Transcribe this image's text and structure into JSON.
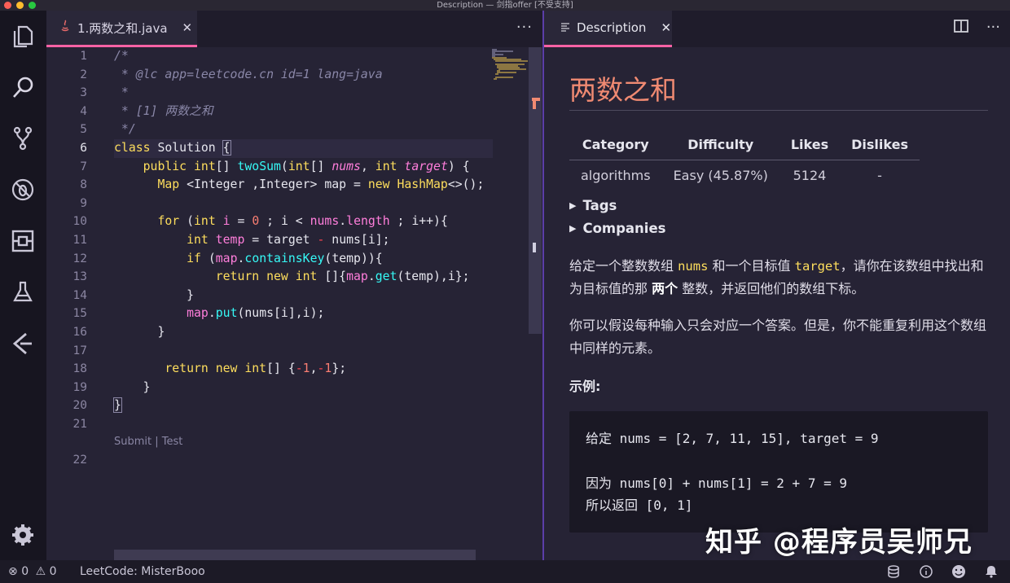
{
  "window": {
    "title": "Description — 剑指offer [不受支持]",
    "traffic_colors": [
      "#ff5f57",
      "#febc2e",
      "#28c840"
    ]
  },
  "colors": {
    "accent": "#ff62a5",
    "split": "#5b3ea8",
    "keyword": "#fede5d",
    "function": "#36f9f6",
    "variable": "#ff7edb",
    "comment": "#8a87a8",
    "number": "#f97e72",
    "heading": "#f08a72"
  },
  "activity_bar": {
    "icons": [
      "files-icon",
      "search-icon",
      "source-control-icon",
      "debug-icon",
      "extensions-icon",
      "test-flask-icon",
      "leetcode-icon",
      "gear-icon"
    ]
  },
  "editor": {
    "tab": {
      "icon": "java-icon",
      "label": "1.两数之和.java",
      "close": "✕"
    },
    "more": "···",
    "lines": [
      {
        "n": "1",
        "segs": [
          [
            "cm",
            "/*"
          ]
        ]
      },
      {
        "n": "2",
        "segs": [
          [
            "cm",
            " * @lc app=leetcode.cn id=1 lang=java"
          ]
        ]
      },
      {
        "n": "3",
        "segs": [
          [
            "cm",
            " *"
          ]
        ]
      },
      {
        "n": "4",
        "segs": [
          [
            "cm",
            " * [1] 两数之和"
          ]
        ]
      },
      {
        "n": "5",
        "segs": [
          [
            "cm",
            " */"
          ]
        ]
      },
      {
        "n": "6",
        "segs": [
          [
            "kw",
            "class "
          ],
          [
            "pl",
            "Solution "
          ],
          [
            "bracket",
            "{"
          ]
        ]
      },
      {
        "n": "7",
        "segs": [
          [
            "pl",
            "    "
          ],
          [
            "kw",
            "public "
          ],
          [
            "ty",
            "int"
          ],
          [
            "pl",
            "[] "
          ],
          [
            "fn",
            "twoSum"
          ],
          [
            "pl",
            "("
          ],
          [
            "ty",
            "int"
          ],
          [
            "pl",
            "[] "
          ],
          [
            "pa",
            "nums"
          ],
          [
            "pl",
            ", "
          ],
          [
            "ty",
            "int "
          ],
          [
            "pa",
            "target"
          ],
          [
            "pl",
            ") {"
          ]
        ]
      },
      {
        "n": "8",
        "segs": [
          [
            "pl",
            "      "
          ],
          [
            "ty",
            "Map "
          ],
          [
            "pl",
            "<Integer ,Integer> map = "
          ],
          [
            "kw",
            "new "
          ],
          [
            "ty",
            "HashMap"
          ],
          [
            "pl",
            "<>();"
          ]
        ]
      },
      {
        "n": "9",
        "segs": []
      },
      {
        "n": "10",
        "segs": [
          [
            "pl",
            "      "
          ],
          [
            "kw",
            "for "
          ],
          [
            "pl",
            "("
          ],
          [
            "ty",
            "int "
          ],
          [
            "va",
            "i"
          ],
          [
            "pl",
            " = "
          ],
          [
            "nu",
            "0"
          ],
          [
            "pl",
            " ; i < "
          ],
          [
            "va",
            "nums"
          ],
          [
            "pl",
            "."
          ],
          [
            "va",
            "length"
          ],
          [
            "pl",
            " ; i++){"
          ]
        ]
      },
      {
        "n": "11",
        "segs": [
          [
            "pl",
            "          "
          ],
          [
            "ty",
            "int "
          ],
          [
            "va",
            "temp"
          ],
          [
            "pl",
            " = target "
          ],
          [
            "op",
            "-"
          ],
          [
            "pl",
            " nums[i];"
          ]
        ]
      },
      {
        "n": "12",
        "segs": [
          [
            "pl",
            "          "
          ],
          [
            "kw",
            "if "
          ],
          [
            "pl",
            "("
          ],
          [
            "va",
            "map"
          ],
          [
            "pl",
            "."
          ],
          [
            "fn",
            "containsKey"
          ],
          [
            "pl",
            "(temp)){"
          ]
        ]
      },
      {
        "n": "13",
        "segs": [
          [
            "pl",
            "              "
          ],
          [
            "kw",
            "return new "
          ],
          [
            "ty",
            "int "
          ],
          [
            "pl",
            "[]{"
          ],
          [
            "va",
            "map"
          ],
          [
            "pl",
            "."
          ],
          [
            "fn",
            "get"
          ],
          [
            "pl",
            "(temp),i};"
          ]
        ]
      },
      {
        "n": "14",
        "segs": [
          [
            "pl",
            "          }"
          ]
        ]
      },
      {
        "n": "15",
        "segs": [
          [
            "pl",
            "          "
          ],
          [
            "va",
            "map"
          ],
          [
            "pl",
            "."
          ],
          [
            "fn",
            "put"
          ],
          [
            "pl",
            "(nums[i],i);"
          ]
        ]
      },
      {
        "n": "16",
        "segs": [
          [
            "pl",
            "      }"
          ]
        ]
      },
      {
        "n": "17",
        "segs": []
      },
      {
        "n": "18",
        "segs": [
          [
            "pl",
            "       "
          ],
          [
            "kw",
            "return new "
          ],
          [
            "ty",
            "int"
          ],
          [
            "pl",
            "[] {"
          ],
          [
            "op",
            "-"
          ],
          [
            "nu",
            "1"
          ],
          [
            "pl",
            ","
          ],
          [
            "op",
            "-"
          ],
          [
            "nu",
            "1"
          ],
          [
            "pl",
            "};"
          ]
        ]
      },
      {
        "n": "19",
        "segs": [
          [
            "pl",
            "    }"
          ]
        ]
      },
      {
        "n": "20",
        "segs": [
          [
            "bracket",
            "}"
          ]
        ]
      },
      {
        "n": "21",
        "segs": []
      }
    ],
    "codelens": "Submit | Test",
    "last_line_number": "22",
    "current_line": "6"
  },
  "preview": {
    "tab": {
      "label": "Description",
      "close": "✕"
    },
    "title": "两数之和",
    "table": {
      "headers": [
        "Category",
        "Difficulty",
        "Likes",
        "Dislikes"
      ],
      "row": [
        "algorithms",
        "Easy (45.87%)",
        "5124",
        "-"
      ]
    },
    "tags_label": "Tags",
    "companies_label": "Companies",
    "para1": {
      "a": "给定一个整数数组 ",
      "code1": "nums",
      "b": " 和一个目标值 ",
      "code2": "target",
      "c": "，请你在该数组中找出和为目标值的那 ",
      "bold": "两个",
      "d": " 整数，并返回他们的数组下标。"
    },
    "para2": "你可以假设每种输入只会对应一个答案。但是，你不能重复利用这个数组中同样的元素。",
    "example_label": "示例:",
    "example": {
      "line1": "给定 nums = [2, 7, 11, 15], target = 9",
      "line2": "因为 nums[0] + nums[1] = 2 + 7 = 9",
      "line3": "所以返回 [0, 1]"
    }
  },
  "watermark": "知乎 @程序员吴师兄",
  "statusbar": {
    "errors": "0",
    "warnings": "0",
    "account": "LeetCode: MisterBooo",
    "right_icons": [
      "database-icon",
      "info-icon",
      "smiley-icon",
      "bell-icon"
    ]
  }
}
